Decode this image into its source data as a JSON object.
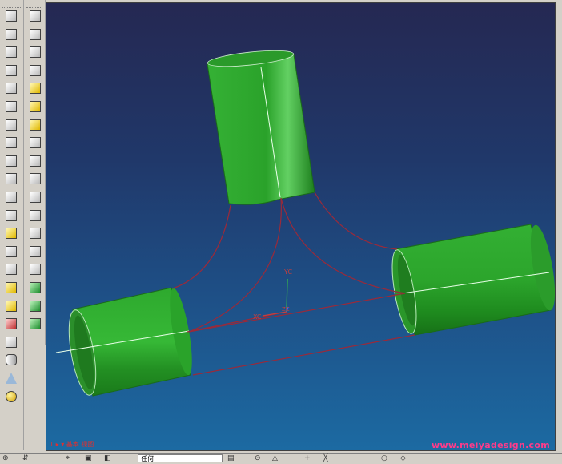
{
  "viewport": {
    "status_text": "1 ▸ ▾ 基本 视图",
    "watermark": "www.meiyadesign.com",
    "wcs_labels": {
      "yc": "YC",
      "xc": "XC",
      "zc": "ZC"
    }
  },
  "colors": {
    "body_green": "#2fa82f",
    "curve_red": "#9a2a3a",
    "bg_top": "#252852",
    "bg_bottom": "#1c6aa2",
    "watermark": "#ff3b8a"
  },
  "toolbar_left": {
    "icons": [
      "sketch-icon",
      "extrude-icon",
      "revolve-icon",
      "sweep-icon",
      "tube-icon",
      "hole-icon",
      "boss-icon",
      "pocket-icon",
      "pad-icon",
      "slot-icon",
      "groove-icon",
      "thread-icon",
      "trim-icon",
      "offset-icon",
      "pattern-icon",
      "datum-plane-icon",
      "datum-axis-icon",
      "csys-icon",
      "block-icon",
      "cylinder-icon",
      "cone-icon",
      "sphere-icon"
    ]
  },
  "toolbar_left2": {
    "icons": [
      "edge-blend-icon",
      "chamfer-icon",
      "face-blend-icon",
      "soft-blend-icon",
      "shell-icon",
      "hollow-icon",
      "draft-icon",
      "scale-icon",
      "split-icon",
      "mirror-icon",
      "patch-icon",
      "simplify-icon",
      "wrap-icon",
      "emboss-icon",
      "offset-face-icon",
      "extract-icon",
      "unite-icon",
      "subtract-icon"
    ]
  },
  "bottom_bar": {
    "selection_value": "任何"
  }
}
